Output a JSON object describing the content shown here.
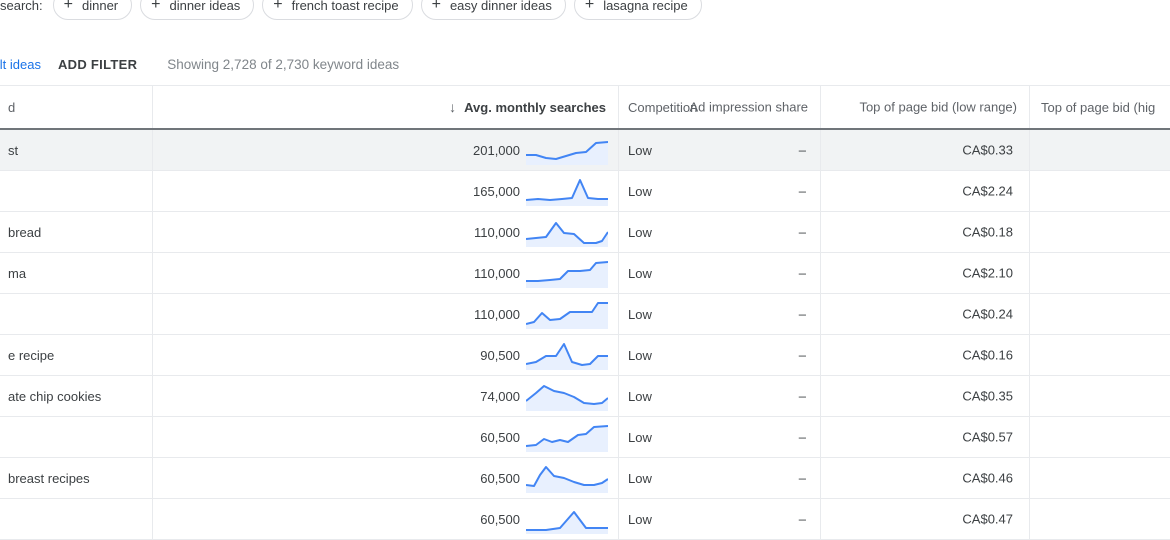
{
  "chips": {
    "label": "search:",
    "plus_icon": "plus-icon",
    "items": [
      {
        "label": "dinner"
      },
      {
        "label": "dinner ideas"
      },
      {
        "label": "french toast recipe"
      },
      {
        "label": "easy dinner ideas"
      },
      {
        "label": "lasagna recipe"
      }
    ]
  },
  "filter_bar": {
    "exclude_link": "de adult ideas",
    "add_filter": "ADD FILTER",
    "showing": "Showing 2,728 of 2,730 keyword ideas"
  },
  "table": {
    "headers": {
      "keyword": "d",
      "searches": "Avg. monthly searches",
      "sort_arrow": "↓",
      "competition": "Competition",
      "ad_impression_share": "Ad impression share",
      "bid_low": "Top of page bid (low range)",
      "bid_high": "Top of page bid (hig"
    },
    "rows": [
      {
        "keyword": "st",
        "searches": "201,000",
        "competition": "Low",
        "ad_share": "–",
        "bid_low": "CA$0.33",
        "bid_high": "",
        "highlight": true,
        "spark": "0,20 10,20 20,23 30,24 40,21 50,18 60,17 70,8 82,7"
      },
      {
        "keyword": "",
        "searches": "165,000",
        "competition": "Low",
        "ad_share": "–",
        "bid_low": "CA$2.24",
        "bid_high": "",
        "highlight": false,
        "spark": "0,24 12,23 24,24 36,23 46,22 54,4 62,22 72,23 82,23"
      },
      {
        "keyword": "bread",
        "searches": "110,000",
        "competition": "Low",
        "ad_share": "–",
        "bid_low": "CA$0.18",
        "bid_high": "",
        "highlight": false,
        "spark": "0,22 10,21 20,20 30,6 38,16 48,17 58,26 70,26 76,24 82,15"
      },
      {
        "keyword": "ma",
        "searches": "110,000",
        "competition": "Low",
        "ad_share": "–",
        "bid_low": "CA$2.10",
        "bid_high": "",
        "highlight": false,
        "spark": "0,23 12,23 24,22 34,21 42,13 54,13 64,12 70,5 82,4"
      },
      {
        "keyword": "",
        "searches": "110,000",
        "competition": "Low",
        "ad_share": "–",
        "bid_low": "CA$0.24",
        "bid_high": "",
        "highlight": false,
        "spark": "0,25 8,23 16,14 24,21 34,20 44,13 56,13 66,13 72,4 82,4"
      },
      {
        "keyword": "e recipe",
        "searches": "90,500",
        "competition": "Low",
        "ad_share": "–",
        "bid_low": "CA$0.16",
        "bid_high": "",
        "highlight": false,
        "spark": "0,24 10,22 20,16 30,16 38,4 46,22 56,25 64,24 72,16 82,16"
      },
      {
        "keyword": "ate chip cookies",
        "searches": "74,000",
        "competition": "Low",
        "ad_share": "–",
        "bid_low": "CA$0.35",
        "bid_high": "",
        "highlight": false,
        "spark": "0,20 10,12 18,5 28,10 38,12 48,16 58,22 68,23 76,22 82,17"
      },
      {
        "keyword": "",
        "searches": "60,500",
        "competition": "Low",
        "ad_share": "–",
        "bid_low": "CA$0.57",
        "bid_high": "",
        "highlight": false,
        "spark": "0,24 10,23 18,17 26,20 34,18 42,20 52,13 60,12 68,5 82,4"
      },
      {
        "keyword": "breast recipes",
        "searches": "60,500",
        "competition": "Low",
        "ad_share": "–",
        "bid_low": "CA$0.46",
        "bid_high": "",
        "highlight": false,
        "spark": "0,22 8,23 14,12 20,4 28,13 38,15 48,19 58,22 68,22 76,20 82,16"
      },
      {
        "keyword": "",
        "searches": "60,500",
        "competition": "Low",
        "ad_share": "–",
        "bid_low": "CA$0.47",
        "bid_high": "",
        "highlight": false,
        "spark": "0,26 20,26 34,24 48,8 60,24 72,24 82,24"
      }
    ]
  },
  "colors": {
    "link": "#1a73e8",
    "spark_line": "#4285f4",
    "spark_fill": "#e8f0fe",
    "row_highlight": "#f1f3f4",
    "border": "#e8eaed",
    "header_rule": "#70757a"
  }
}
